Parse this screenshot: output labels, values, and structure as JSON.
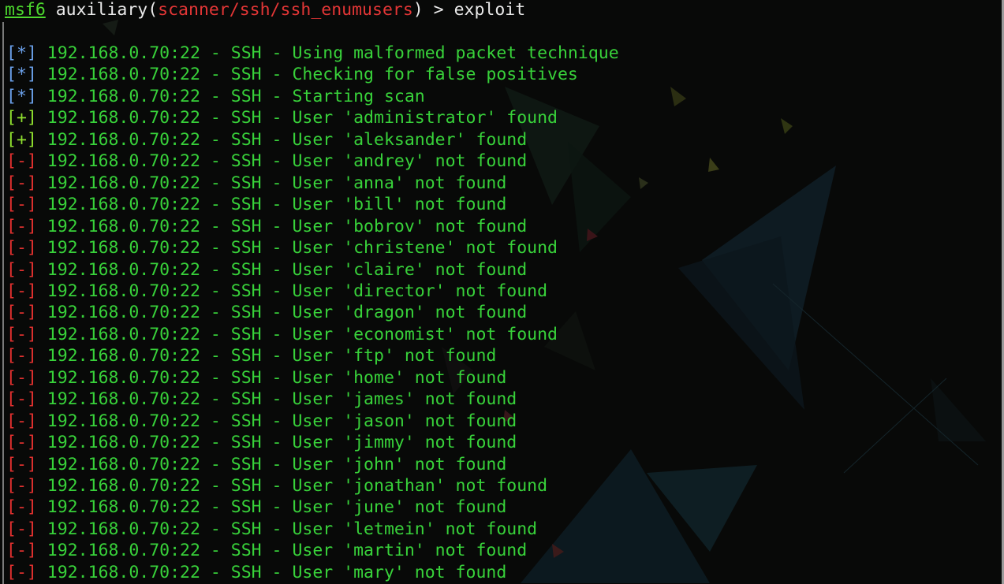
{
  "terminal": {
    "prompt": {
      "console": "msf6",
      "prefix": " auxiliary(",
      "module": "scanner/ssh/ssh_enumusers",
      "suffix": ") > ",
      "command": "exploit"
    },
    "lines": [
      {
        "tag": "[*]",
        "type": "info",
        "text": " 192.168.0.70:22 - SSH - Using malformed packet technique"
      },
      {
        "tag": "[*]",
        "type": "info",
        "text": " 192.168.0.70:22 - SSH - Checking for false positives"
      },
      {
        "tag": "[*]",
        "type": "info",
        "text": " 192.168.0.70:22 - SSH - Starting scan"
      },
      {
        "tag": "[+]",
        "type": "ok",
        "text": " 192.168.0.70:22 - SSH - User 'administrator' found"
      },
      {
        "tag": "[+]",
        "type": "ok",
        "text": " 192.168.0.70:22 - SSH - User 'aleksander' found"
      },
      {
        "tag": "[-]",
        "type": "err",
        "text": " 192.168.0.70:22 - SSH - User 'andrey' not found"
      },
      {
        "tag": "[-]",
        "type": "err",
        "text": " 192.168.0.70:22 - SSH - User 'anna' not found"
      },
      {
        "tag": "[-]",
        "type": "err",
        "text": " 192.168.0.70:22 - SSH - User 'bill' not found"
      },
      {
        "tag": "[-]",
        "type": "err",
        "text": " 192.168.0.70:22 - SSH - User 'bobrov' not found"
      },
      {
        "tag": "[-]",
        "type": "err",
        "text": " 192.168.0.70:22 - SSH - User 'christene' not found"
      },
      {
        "tag": "[-]",
        "type": "err",
        "text": " 192.168.0.70:22 - SSH - User 'claire' not found"
      },
      {
        "tag": "[-]",
        "type": "err",
        "text": " 192.168.0.70:22 - SSH - User 'director' not found"
      },
      {
        "tag": "[-]",
        "type": "err",
        "text": " 192.168.0.70:22 - SSH - User 'dragon' not found"
      },
      {
        "tag": "[-]",
        "type": "err",
        "text": " 192.168.0.70:22 - SSH - User 'economist' not found"
      },
      {
        "tag": "[-]",
        "type": "err",
        "text": " 192.168.0.70:22 - SSH - User 'ftp' not found"
      },
      {
        "tag": "[-]",
        "type": "err",
        "text": " 192.168.0.70:22 - SSH - User 'home' not found"
      },
      {
        "tag": "[-]",
        "type": "err",
        "text": " 192.168.0.70:22 - SSH - User 'james' not found"
      },
      {
        "tag": "[-]",
        "type": "err",
        "text": " 192.168.0.70:22 - SSH - User 'jason' not found"
      },
      {
        "tag": "[-]",
        "type": "err",
        "text": " 192.168.0.70:22 - SSH - User 'jimmy' not found"
      },
      {
        "tag": "[-]",
        "type": "err",
        "text": " 192.168.0.70:22 - SSH - User 'john' not found"
      },
      {
        "tag": "[-]",
        "type": "err",
        "text": " 192.168.0.70:22 - SSH - User 'jonathan' not found"
      },
      {
        "tag": "[-]",
        "type": "err",
        "text": " 192.168.0.70:22 - SSH - User 'june' not found"
      },
      {
        "tag": "[-]",
        "type": "err",
        "text": " 192.168.0.70:22 - SSH - User 'letmein' not found"
      },
      {
        "tag": "[-]",
        "type": "err",
        "text": " 192.168.0.70:22 - SSH - User 'martin' not found"
      },
      {
        "tag": "[-]",
        "type": "err",
        "text": " 192.168.0.70:22 - SSH - User 'mary' not found"
      }
    ]
  },
  "colors": {
    "background": "#080908",
    "prompt_console": "#4cd82e",
    "prompt_module": "#e33636",
    "tag_info": "#6a9fe8",
    "tag_ok": "#8fe02f",
    "tag_err": "#e2312f",
    "message": "#38d23a"
  }
}
